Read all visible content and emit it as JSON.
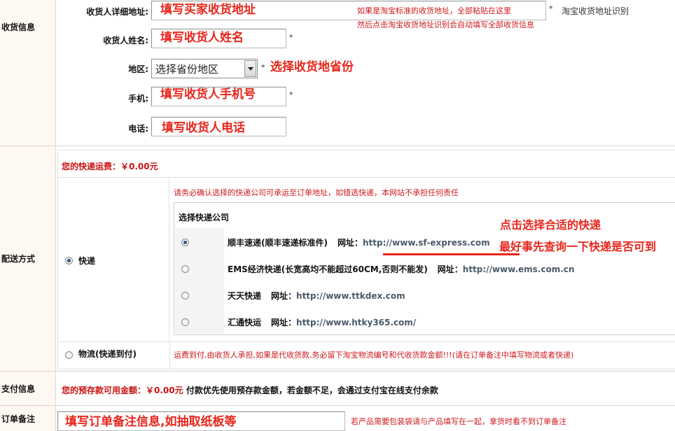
{
  "sections": {
    "shipping_info": "收货信息",
    "delivery_method": "配送方式",
    "payment_info": "支付信息",
    "order_note": "订单备注"
  },
  "address": {
    "detail_label": "收货人详细地址:",
    "detail_annotation": "填写买家收货地址",
    "taobao_note_line1": "如果是淘宝标准的收货地址，全部粘贴在这里",
    "taobao_note_line2": "然后点击淘宝收货地址识别会自动填写全部收货信息",
    "taobao_recognize_link": "淘宝收货地址识别",
    "name_label": "收货人姓名:",
    "name_annotation": "填写收货人姓名",
    "region_label": "地区:",
    "region_select_value": "选择省份地区",
    "region_annotation": "选择收货地省份",
    "mobile_label": "手机:",
    "mobile_annotation": "填写收货人手机号",
    "phone_label": "电话:",
    "phone_annotation": "填写收货人电话",
    "required_mark": "*"
  },
  "delivery": {
    "fee_label": "您的快递运费：",
    "fee_value": "￥0.00元",
    "confirm_note": "请务必确认选择的快递公司可承运至订单地址，如错选快递，本网站不承担任何责任",
    "select_courier_title": "选择快递公司",
    "annotation_line1": "点击选择合适的快递",
    "annotation_line2": "最好事先查询一下快递是否可到",
    "url_label": "网址：",
    "express_option": "快递",
    "logistics_option": "物流(快递到付)",
    "logistics_note": "运费到付,由收货人承担,如果是代收货款,务必留下淘宝物流编号和代收货款金额!!!(请在订单备注中填写物流或者快递)",
    "couriers": [
      {
        "name": "顺丰速递(顺丰速递标准件)",
        "url": "http://www.sf-express.com",
        "selected": true
      },
      {
        "name": "EMS经济快递(长宽高均不能超过60CM,否则不能发)",
        "url": "http://www.ems.com.cn",
        "selected": false
      },
      {
        "name": "天天快递",
        "url": "http://www.ttkdex.com",
        "selected": false
      },
      {
        "name": "汇通快运",
        "url": "http://www.htky365.com/",
        "selected": false
      }
    ]
  },
  "payment": {
    "balance_label": "您的预存款可用金额：",
    "balance_value": "￥0.00元",
    "balance_note": "付款优先使用预存款金额，若金额不足，会通过支付宝在线支付余款"
  },
  "note": {
    "annotation": "填写订单备注信息,如抽取纸板等",
    "side_note": "若产品需要包装袋请与产品填写在一起，拿货时看不到订单备注"
  },
  "colors": {
    "annotation_red": "#e8261c",
    "label_bg": "#fdf8f1",
    "underline_red": "#e8261c"
  }
}
